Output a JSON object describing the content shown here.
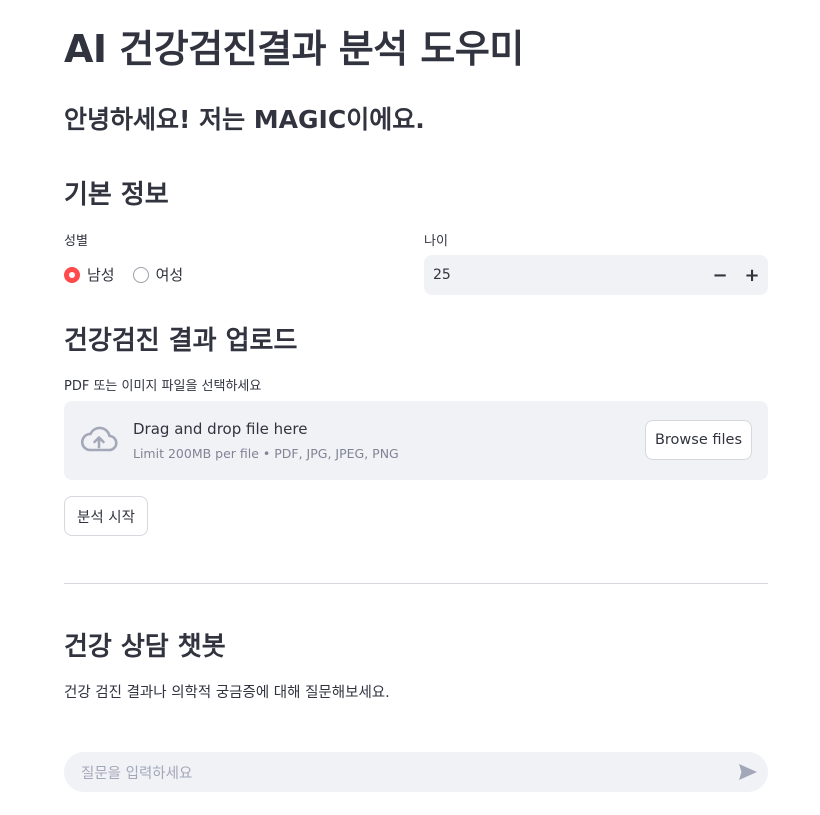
{
  "header": {
    "title": "AI 건강검진결과 분석 도우미",
    "greeting": "안녕하세요! 저는 MAGIC이에요."
  },
  "basic_info": {
    "heading": "기본 정보",
    "gender": {
      "label": "성별",
      "options": [
        {
          "label": "남성",
          "selected": true
        },
        {
          "label": "여성",
          "selected": false
        }
      ]
    },
    "age": {
      "label": "나이",
      "value": "25",
      "decrement": "−",
      "increment": "+"
    }
  },
  "upload": {
    "heading": "건강검진 결과 업로드",
    "label": "PDF 또는 이미지 파일을 선택하세요",
    "dropzone_text": "Drag and drop file here",
    "limit_text": "Limit 200MB per file • PDF, JPG, JPEG, PNG",
    "browse_label": "Browse files",
    "icon": "cloud-upload-icon"
  },
  "analyze_button": "분석 시작",
  "chatbot": {
    "heading": "건강 상담 챗봇",
    "description": "건강 검진 결과나 의학적 궁금증에 대해 질문해보세요.",
    "input_placeholder": "질문을 입력하세요",
    "send_icon": "send-icon"
  },
  "colors": {
    "accent": "#ff4b4b",
    "input_bg": "#f0f2f6",
    "text": "#31333f",
    "muted": "#808495"
  }
}
